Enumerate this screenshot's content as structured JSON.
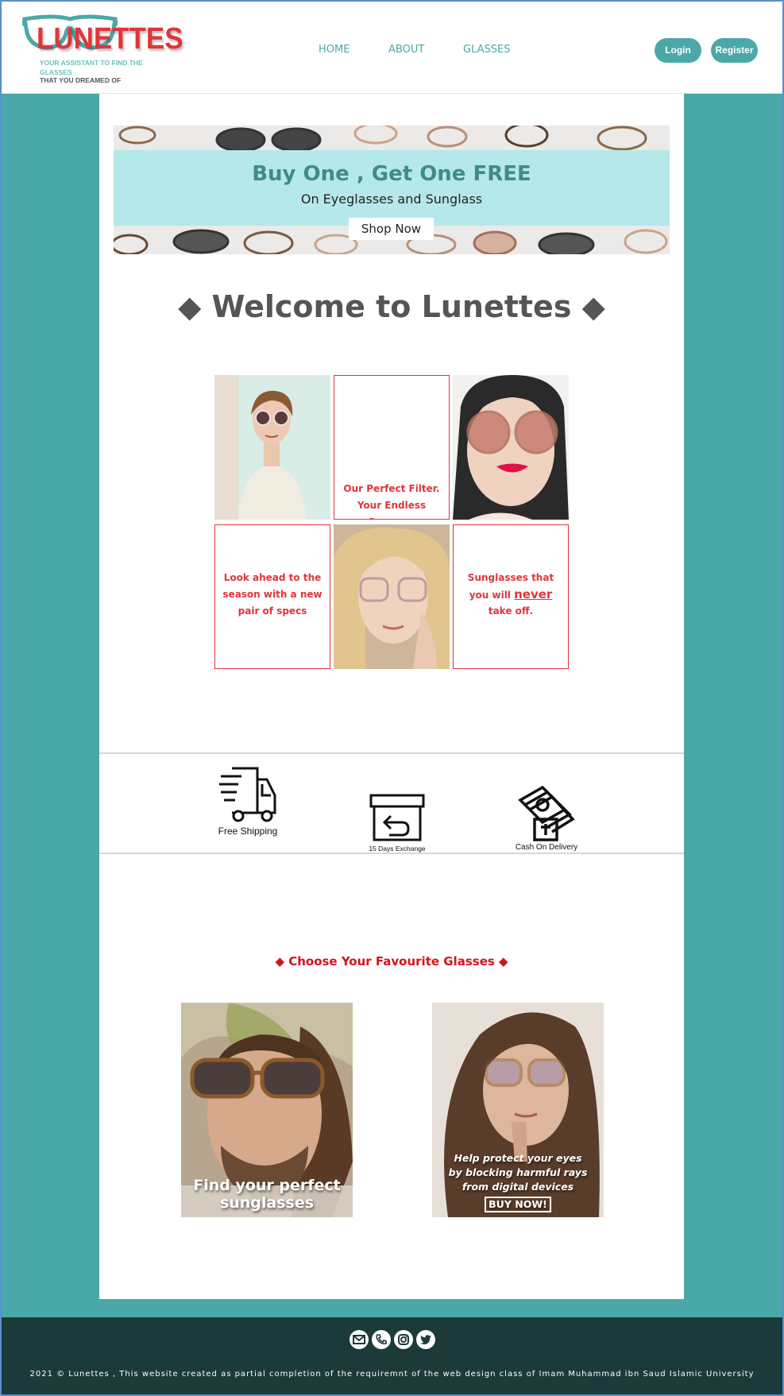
{
  "header": {
    "logo_text": "LUNETTES",
    "tagline_line1": "YOUR ASSISTANT TO FIND THE GLASSES",
    "tagline_line2": "THAT YOU DREAMED OF",
    "nav": [
      "HOME",
      "ABOUT",
      "GLASSES"
    ],
    "login_label": "Login",
    "register_label": "Register"
  },
  "banner": {
    "title": "Buy One , Get One FREE",
    "subtitle": "On Eyeglasses and Sunglass",
    "cta": "Shop Now"
  },
  "welcome": "◆ Welcome to Lunettes ◆",
  "grid": {
    "tile1_line1": "Our Perfect Filter.",
    "tile1_line2": "Your Endless Summer.",
    "tile2_line1": "Look ahead to the",
    "tile2_line2": "season with a new",
    "tile2_line3": "pair of specs",
    "tile3_line1": "Sunglasses that",
    "tile3_line2a": "you will ",
    "tile3_line2b": "never",
    "tile3_line3": "take off."
  },
  "features": {
    "shipping": "Free Shipping",
    "exchange": "15 Days Exchange",
    "cod": "Cash On Delivery"
  },
  "choose_heading": "◆ Choose Your Favourite Glasses ◆",
  "promos": {
    "sunglasses_line1": "Find your perfect",
    "sunglasses_line2": "sunglasses",
    "eyes_line1": "Help protect your eyes",
    "eyes_line2": "by blocking  harmful rays",
    "eyes_line3": "from digital devices",
    "eyes_cta": "BUY NOW!"
  },
  "footer": {
    "icons": [
      "email-icon",
      "phone-icon",
      "instagram-icon",
      "twitter-icon"
    ],
    "copyright": "2021 © Lunettes , This website created as partial completion of the requiremnt of the web design class of Imam Muhammad ibn Saud Islamic University"
  },
  "colors": {
    "teal": "#4aa9a8",
    "brand_red": "#e0353b",
    "footer_bg": "#1d3a3a",
    "banner_stripe": "#b5e8ea"
  }
}
